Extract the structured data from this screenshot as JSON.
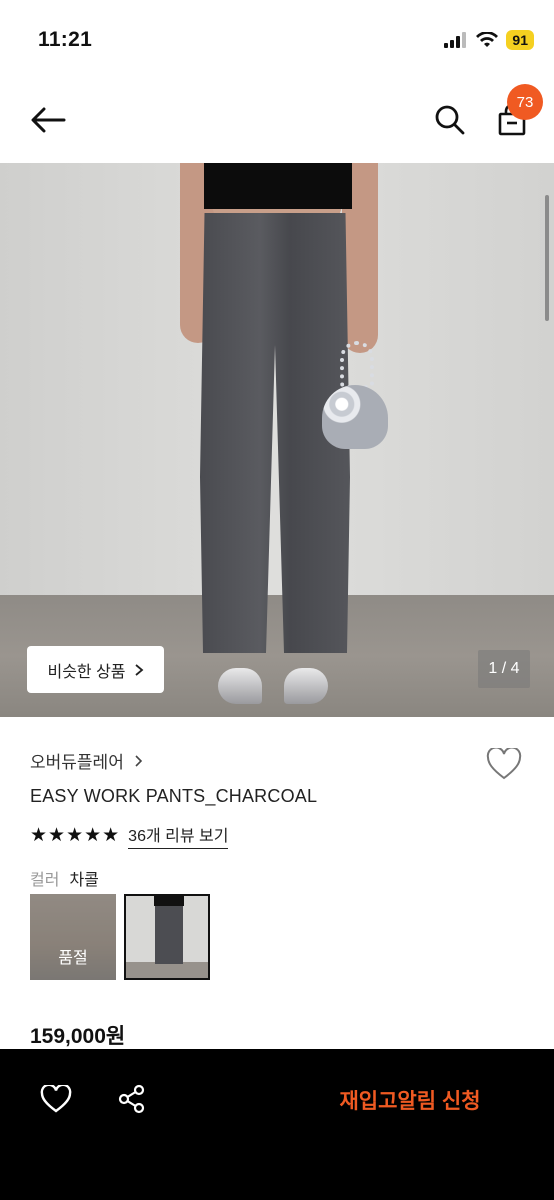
{
  "status_bar": {
    "time": "11:21",
    "battery": "91"
  },
  "header": {
    "cart_count": "73"
  },
  "gallery": {
    "similar_button": "비슷한 상품",
    "page_indicator": "1 / 4"
  },
  "product": {
    "brand": "오버듀플레어",
    "name": "EASY WORK PANTS_CHARCOAL",
    "stars": "★★★★★",
    "review_link": "36개 리뷰 보기",
    "color_label": "컬러",
    "color_value": "차콜",
    "swatches": [
      {
        "status": "품절"
      }
    ],
    "price": "159,000원"
  },
  "bottom_bar": {
    "restock_button": "재입고알림 신청"
  },
  "colors": {
    "accent": "#f05a22",
    "bottom_bar_bg": "#000000"
  },
  "icons": [
    "back-arrow-icon",
    "search-icon",
    "shopping-bag-icon",
    "heart-icon",
    "share-icon",
    "chevron-right-icon"
  ]
}
